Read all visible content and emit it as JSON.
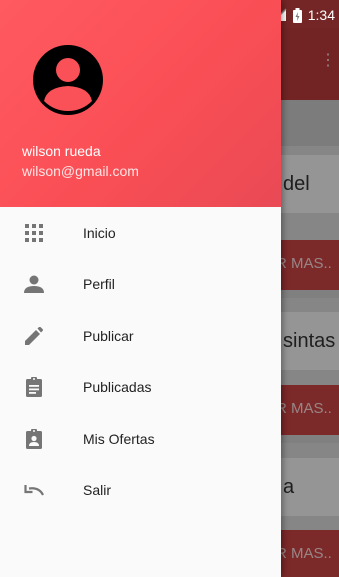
{
  "status_bar": {
    "time": "1:34"
  },
  "background": {
    "cards": [
      {
        "text": "del"
      },
      {
        "text": "sintas"
      },
      {
        "text": "a"
      }
    ],
    "button_label": "R MAS.."
  },
  "drawer": {
    "user": {
      "name": "wilson rueda",
      "email": "wilson@gmail.com"
    },
    "items": [
      {
        "label": "Inicio",
        "icon": "apps-grid-icon"
      },
      {
        "label": "Perfil",
        "icon": "person-icon"
      },
      {
        "label": "Publicar",
        "icon": "pencil-icon"
      },
      {
        "label": "Publicadas",
        "icon": "clipboard-icon"
      },
      {
        "label": "Mis Ofertas",
        "icon": "clipboard-account-icon"
      },
      {
        "label": "Salir",
        "icon": "undo-icon"
      }
    ]
  },
  "colors": {
    "header_accent": "#fa4e55",
    "app_bar": "#b83a3a",
    "icon": "#757575"
  }
}
